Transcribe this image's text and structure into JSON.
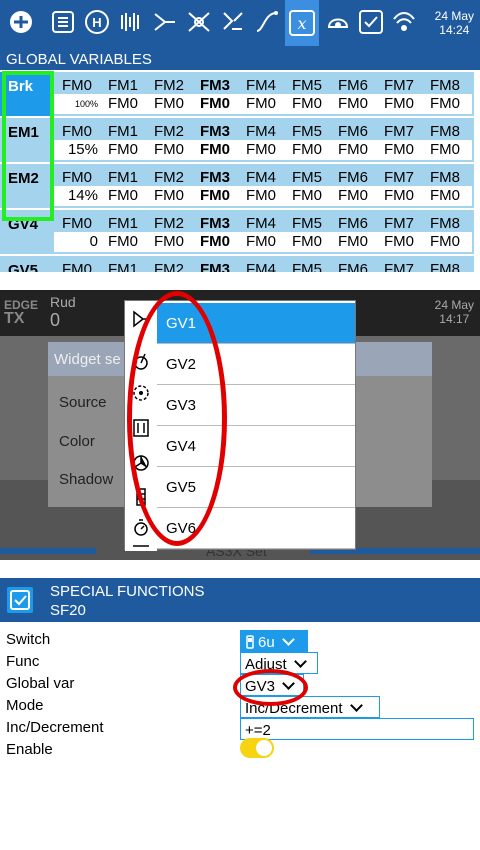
{
  "global_vars": {
    "date": "24 May",
    "time": "14:24",
    "title": "GLOBAL VARIABLES",
    "flight_modes": [
      "FM0",
      "FM1",
      "FM2",
      "FM3",
      "FM4",
      "FM5",
      "FM6",
      "FM7",
      "FM8"
    ],
    "rows": [
      {
        "name": "Brk",
        "first_value": "100%",
        "values": [
          "FM0",
          "FM0",
          "FM0",
          "FM0",
          "FM0",
          "FM0",
          "FM0",
          "FM0"
        ]
      },
      {
        "name": "EM1",
        "first_value": "15%",
        "values": [
          "FM0",
          "FM0",
          "FM0",
          "FM0",
          "FM0",
          "FM0",
          "FM0",
          "FM0"
        ]
      },
      {
        "name": "EM2",
        "first_value": "14%",
        "values": [
          "FM0",
          "FM0",
          "FM0",
          "FM0",
          "FM0",
          "FM0",
          "FM0",
          "FM0"
        ]
      },
      {
        "name": "GV4",
        "first_value": "0",
        "values": [
          "FM0",
          "FM0",
          "FM0",
          "FM0",
          "FM0",
          "FM0",
          "FM0",
          "FM0"
        ]
      },
      {
        "name": "GV5",
        "first_value": "",
        "values": []
      }
    ],
    "icons": [
      "radio-setup-icon",
      "model-list-icon",
      "heli-icon",
      "flight-modes-icon",
      "inputs-icon",
      "mixes-icon",
      "outputs-icon",
      "curves-icon",
      "global-vars-icon",
      "logical-switches-icon",
      "special-functions-icon",
      "telemetry-icon"
    ]
  },
  "widget_settings": {
    "logo_line1": "EDGE",
    "logo_line2": "TX",
    "rud_label": "Rud",
    "rud_value": "0",
    "date": "24 May",
    "time": "14:17",
    "dialog_title": "Widget se",
    "labels": [
      "Source",
      "Color",
      "Shadow"
    ],
    "footer_text": "AS3X Set",
    "popup_items": [
      "GV1",
      "GV2",
      "GV3",
      "GV4",
      "GV5",
      "GV6"
    ],
    "selected_item": "GV1"
  },
  "special_function": {
    "title": "SPECIAL FUNCTIONS",
    "subtitle": "SF20",
    "fields": [
      {
        "label": "Switch",
        "value": "6u",
        "selected": true
      },
      {
        "label": "Func",
        "value": "Adjust"
      },
      {
        "label": "Global var",
        "value": "GV3"
      },
      {
        "label": "Mode",
        "value": "Inc/Decrement"
      },
      {
        "label": "Inc/Decrement",
        "value": "+=2"
      },
      {
        "label": "Enable",
        "value": ""
      }
    ],
    "enable_on": true,
    "accent_color": "#1d9bea",
    "toggle_color": "#f7d411"
  },
  "colors": {
    "header_blue": "#1f5a9f",
    "light_blue": "#a4d3ee",
    "highlight_green": "#22ee22",
    "annotation_red": "#e00000"
  }
}
